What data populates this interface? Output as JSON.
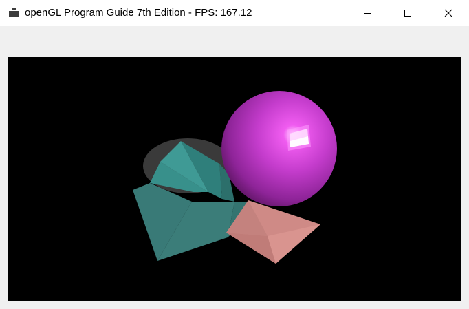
{
  "window": {
    "title": "openGL Program Guide 7th Edition - FPS: 167.12",
    "icon": "app-window-icon",
    "controls": {
      "minimize": "minimize-icon",
      "maximize": "maximize-icon",
      "close": "close-icon"
    }
  },
  "scene": {
    "background": "#000000",
    "objects": [
      {
        "name": "cone",
        "color": "#3a8a86"
      },
      {
        "name": "octahedron",
        "color": "#d28a86"
      },
      {
        "name": "sphere",
        "color": "#c23fcc"
      }
    ]
  },
  "colors": {
    "titlebar": "#ffffff",
    "client": "#f0f0f0"
  }
}
